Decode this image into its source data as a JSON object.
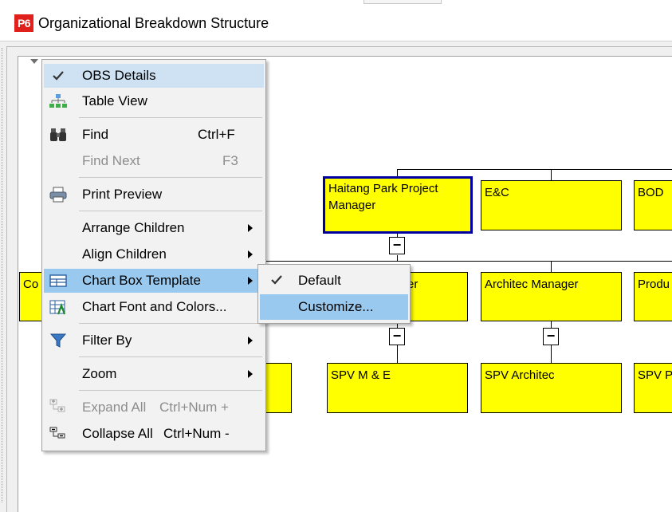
{
  "window": {
    "app_badge": "P6",
    "title": "Organizational Breakdown Structure"
  },
  "colors": {
    "node_fill": "#ffff00",
    "selected_border": "#0000a0",
    "menu_highlight": "#99c9ef",
    "logo_red": "#e0201a"
  },
  "chart": {
    "row1": [
      {
        "label": "Haitang Park Project Manager",
        "selected": true
      },
      {
        "label": "E&C"
      },
      {
        "label": "BOD"
      }
    ],
    "row2": [
      {
        "label": "Co"
      },
      {
        "label": "er"
      },
      {
        "label": "Architec Manager"
      },
      {
        "label": "Produ"
      }
    ],
    "row3": [
      {
        "label": ""
      },
      {
        "label": "SPV M & E"
      },
      {
        "label": "SPV Architec"
      },
      {
        "label": "SPV P"
      }
    ],
    "collapse_symbol": "−"
  },
  "context_menu": {
    "items": [
      {
        "label": "OBS Details",
        "icon": "check-icon",
        "checked": true
      },
      {
        "label": "Table View",
        "icon": "hierarchy-icon"
      },
      {
        "label": "Find",
        "shortcut": "Ctrl+F",
        "icon": "binoculars-icon"
      },
      {
        "label": "Find Next",
        "shortcut": "F3",
        "disabled": true
      },
      {
        "label": "Print Preview",
        "icon": "printer-icon"
      },
      {
        "label": "Arrange Children",
        "submenu": true
      },
      {
        "label": "Align Children",
        "submenu": true
      },
      {
        "label": "Chart Box Template",
        "icon": "box-template-icon",
        "submenu": true,
        "highlighted": true
      },
      {
        "label": "Chart Font and Colors...",
        "icon": "font-colors-icon"
      },
      {
        "label": "Filter By",
        "icon": "filter-icon",
        "submenu": true
      },
      {
        "label": "Zoom",
        "submenu": true
      },
      {
        "label": "Expand All",
        "shortcut": "Ctrl+Num +",
        "icon": "expand-all-icon",
        "disabled": true
      },
      {
        "label": "Collapse All",
        "shortcut": "Ctrl+Num -",
        "icon": "collapse-all-icon"
      }
    ]
  },
  "chart_box_submenu": {
    "items": [
      {
        "label": "Default",
        "checked": true
      },
      {
        "label": "Customize...",
        "highlighted": true
      }
    ]
  }
}
